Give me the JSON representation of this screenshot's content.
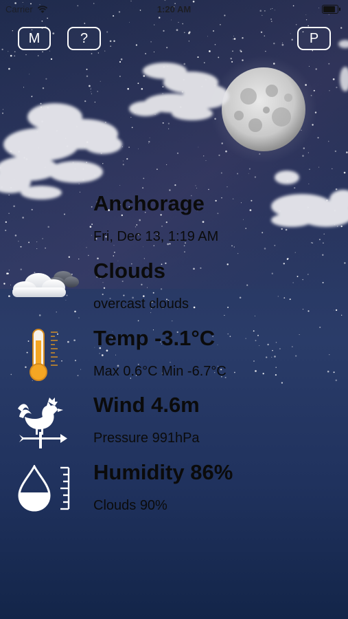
{
  "status_bar": {
    "carrier": "Carrier",
    "time": "1:20 AM"
  },
  "top_buttons": {
    "m": "M",
    "help": "?",
    "p": "P"
  },
  "weather": {
    "city": "Anchorage",
    "datetime": "Fri, Dec 13, 1:19 AM",
    "condition": "Clouds",
    "description": "overcast clouds",
    "temp": "Temp -3.1°C",
    "temp_range": "Max 0.6°C Min -6.7°C",
    "wind": "Wind 4.6m",
    "pressure": "Pressure 991hPa",
    "humidity": "Humidity 86%",
    "clouds": "Clouds 90%"
  },
  "icons": {
    "condition": "cloud-moon-icon",
    "temperature": "thermometer-icon",
    "wind": "weathervane-rooster-icon",
    "humidity": "water-drop-gauge-icon"
  },
  "colors": {
    "sky_top": "#1f2b4d",
    "sky_bottom": "#132549",
    "text": "#0b0b0b",
    "button_border": "#ffffff",
    "thermometer": "#f5a623"
  }
}
